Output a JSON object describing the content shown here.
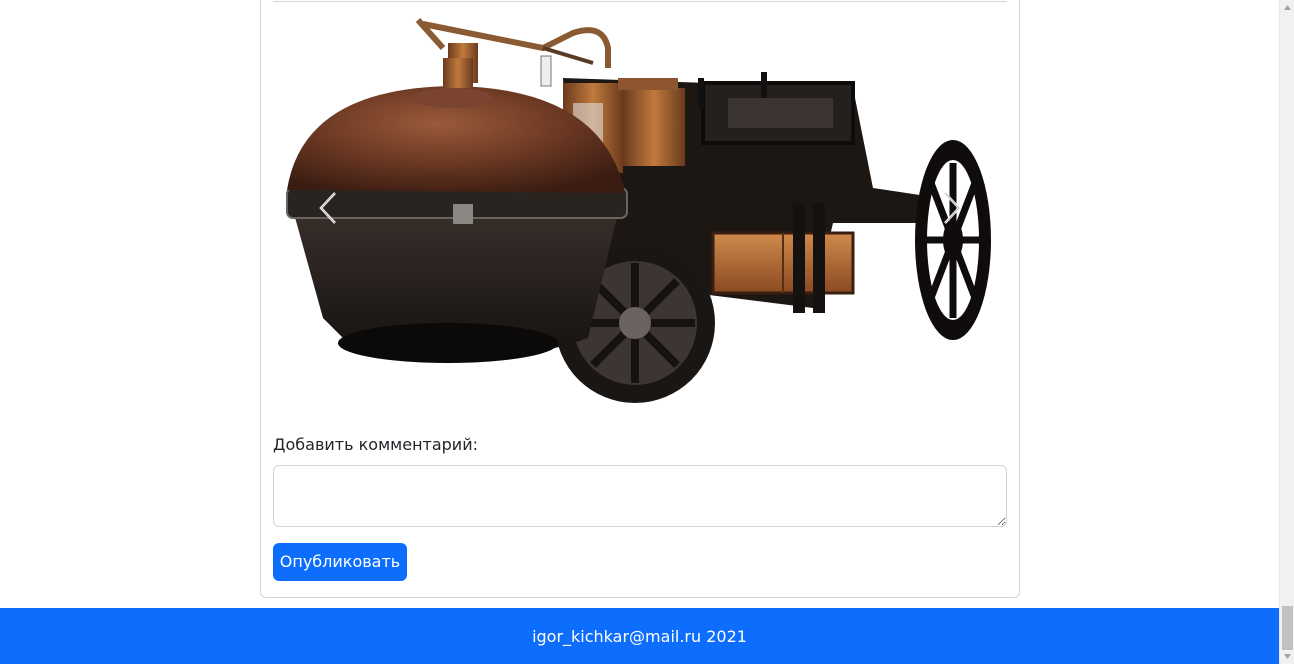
{
  "gallery": {
    "image_alt": "Паровая повозка Кюньо",
    "prev_label": "Previous",
    "next_label": "Next",
    "prev_icon": "chevron-left-icon",
    "next_icon": "chevron-right-icon"
  },
  "comment": {
    "label": "Добавить комментарий:",
    "value": "",
    "placeholder": ""
  },
  "publish_button": {
    "label": "Опубликовать"
  },
  "footer": {
    "text": "igor_kichkar@mail.ru 2021"
  },
  "colors": {
    "primary": "#0d6efd",
    "border": "#ced4da",
    "text": "#212529"
  }
}
